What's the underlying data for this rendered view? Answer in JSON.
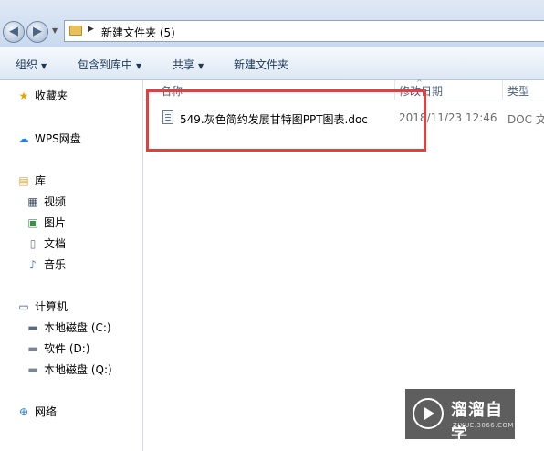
{
  "address": {
    "path": "新建文件夹 (5)"
  },
  "toolbar": {
    "organize": "组织",
    "include_in_library": "包含到库中",
    "share": "共享",
    "new_folder": "新建文件夹"
  },
  "sidebar": {
    "favorites": "收藏夹",
    "wps": "WPS网盘",
    "library": "库",
    "video": "视频",
    "pictures": "图片",
    "documents": "文档",
    "music": "音乐",
    "computer": "计算机",
    "drive_c": "本地磁盘 (C:)",
    "drive_d": "软件 (D:)",
    "drive_q": "本地磁盘 (Q:)",
    "network": "网络"
  },
  "columns": {
    "name": "名称",
    "date": "修改日期",
    "type": "类型"
  },
  "files": [
    {
      "name": "549.灰色简约发展甘特图PPT图表.doc",
      "date": "2018/11/23 12:46",
      "type": "DOC 文"
    }
  ],
  "watermark": {
    "title": "溜溜自学",
    "sub": "ZIXUE.3066.COM"
  },
  "colors": {
    "highlight": "#e04040",
    "accent": "#1e395b"
  }
}
